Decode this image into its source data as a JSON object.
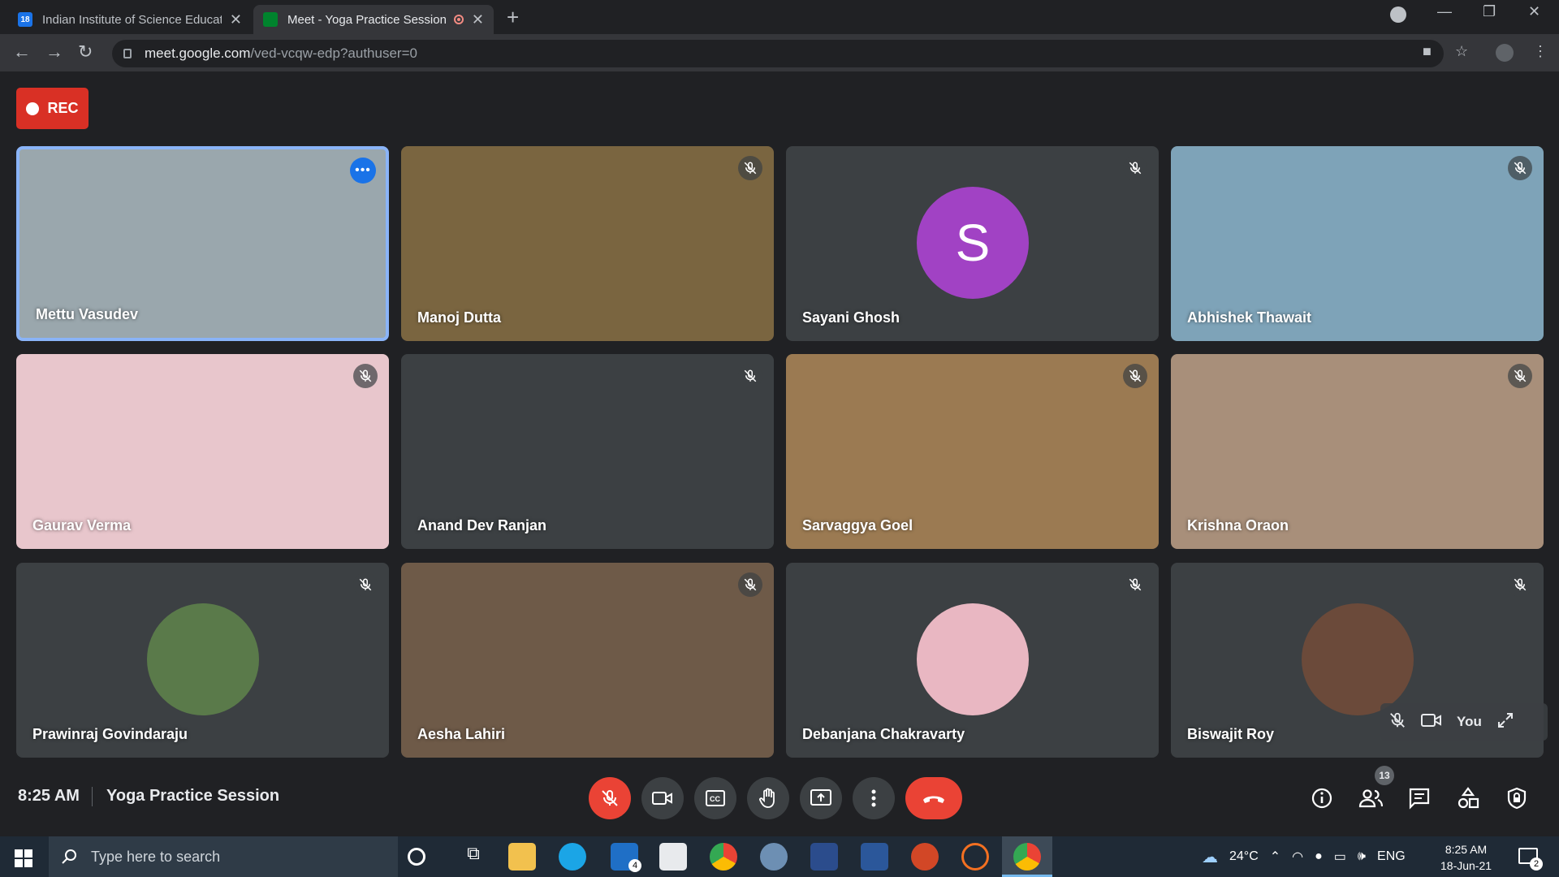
{
  "browser": {
    "tabs": [
      {
        "title": "Indian Institute of Science Educat",
        "favicon_color": "#1a73e8",
        "favicon_text": "18"
      },
      {
        "title": "Meet - Yoga Practice Session",
        "favicon_color": "#00832d"
      }
    ],
    "url_host": "meet.google.com",
    "url_path": "/ved-vcqw-edp?authuser=0"
  },
  "rec_label": "REC",
  "participants": [
    {
      "name": "Mettu Vasudev",
      "bg": "#9aa7ad",
      "active": true
    },
    {
      "name": "Manoj Dutta",
      "bg": "#7a6540"
    },
    {
      "name": "Sayani Ghosh",
      "bg": "#3c4043",
      "letter": "S"
    },
    {
      "name": "Abhishek Thawait",
      "bg": "#7ea3b8"
    },
    {
      "name": "Gaurav Verma",
      "bg": "#e8c6cc"
    },
    {
      "name": "Anand Dev Ranjan",
      "bg": "#3c4043"
    },
    {
      "name": "Sarvaggya Goel",
      "bg": "#9b7a52"
    },
    {
      "name": "Krishna Oraon",
      "bg": "#a88f7a"
    },
    {
      "name": "Prawinraj Govindaraju",
      "bg": "#3c4043",
      "avatar": "#5a7a4a"
    },
    {
      "name": "Aesha Lahiri",
      "bg": "#6e5a48"
    },
    {
      "name": "Debanjana Chakravarty",
      "bg": "#3c4043",
      "avatar": "#e9b7c2"
    },
    {
      "name": "Biswajit Roy",
      "bg": "#3c4043",
      "avatar": "#6b4a3a"
    }
  ],
  "self_label": "You",
  "bottom": {
    "time": "8:25 AM",
    "meeting_name": "Yoga Practice Session",
    "people_count": "13"
  },
  "taskbar": {
    "search_placeholder": "Type here to search",
    "mail_badge": "4",
    "weather": "24°C",
    "lang": "ENG",
    "time": "8:25 AM",
    "date": "18-Jun-21",
    "notifications": "2"
  }
}
